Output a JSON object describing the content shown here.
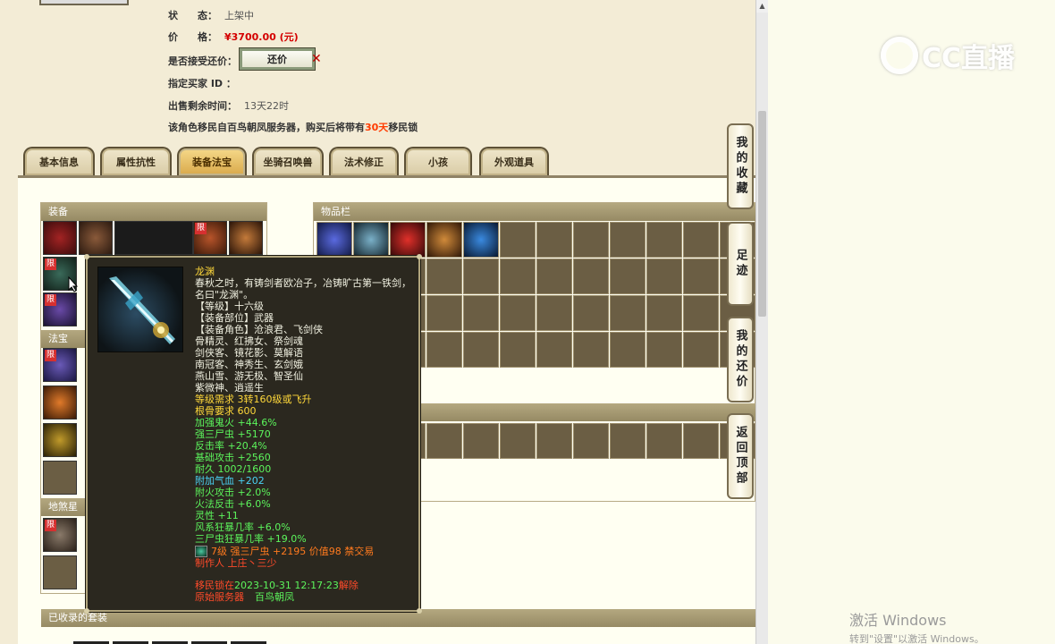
{
  "info": {
    "status_label": "状　　态：",
    "status_value": "上架中",
    "price_label": "价　　格：",
    "price_value": "¥3700.00 (元)",
    "accept_label": "是否接受还价：",
    "counter_button": "还价",
    "buyer_label": "指定买家 ID ：",
    "remaining_label": "出售剩余时间：",
    "remaining_value": "13天22时",
    "migrate_prefix": "该角色移民自百鸟朝凤服务器，购买后将带有",
    "migrate_highlight": "30天",
    "migrate_suffix": "移民锁"
  },
  "tabs": [
    "基本信息",
    "属性抗性",
    "装备法宝",
    "坐骑召唤兽",
    "法术修正",
    "小孩",
    "外观道具"
  ],
  "active_tab": "装备法宝",
  "panels": {
    "equipment": "装备",
    "inventory": "物品栏",
    "treasure": "法宝",
    "earth_treasure": "地煞星",
    "collected_sets": "已收录的套装"
  },
  "limit_badge": "限",
  "side_nav": [
    "我的收藏",
    "足迹",
    "我的还价",
    "返回顶部"
  ],
  "tooltip": {
    "name": "龙渊",
    "desc": "春秋之时，有铸剑者欧冶子，冶铸旷古第一铁剑，名曰\"龙渊\"。",
    "lines": [
      {
        "text": "【等级】十六级",
        "color": "white"
      },
      {
        "text": "【装备部位】武器",
        "color": "white"
      },
      {
        "text": "【装备角色】沧浪君、飞剑侠",
        "color": "white"
      },
      {
        "text": "骨精灵、红拂女、祭剑魂",
        "color": "white"
      },
      {
        "text": "剑侠客、镜花影、莫解语",
        "color": "white"
      },
      {
        "text": "南冠客、神秀生、玄剑娥",
        "color": "white"
      },
      {
        "text": "燕山雪、游无极、智圣仙",
        "color": "white"
      },
      {
        "text": "紫微神、逍遥生",
        "color": "white"
      },
      {
        "text": "等级需求 3转160级或飞升",
        "color": "yellow"
      },
      {
        "text": "根骨要求 600",
        "color": "yellow"
      },
      {
        "text": "加强鬼火 +44.6%",
        "color": "green"
      },
      {
        "text": "强三尸虫 +5170",
        "color": "green"
      },
      {
        "text": "反击率 +20.4%",
        "color": "green"
      },
      {
        "text": "基础攻击 +2560",
        "color": "green"
      },
      {
        "text": "耐久 1002/1600",
        "color": "green"
      },
      {
        "text": "附加气血 +202",
        "color": "cyan"
      },
      {
        "text": "附火攻击 +2.0%",
        "color": "green"
      },
      {
        "text": "火法反击 +6.0%",
        "color": "green"
      },
      {
        "text": "灵性 +11",
        "color": "green"
      },
      {
        "text": "风系狂暴几率 +6.0%",
        "color": "green"
      },
      {
        "text": "三尸虫狂暴几率 +19.0%",
        "color": "green"
      }
    ],
    "gem_line": "7级 强三尸虫 +2195 价值98 禁交易",
    "maker": "制作人 上庄丶三少",
    "migrate_prefix": "移民锁在",
    "migrate_time": "2023-10-31 12:17:23",
    "migrate_suffix": "解除",
    "origin_label": "原始服务器",
    "origin_server": "百鸟朝凤"
  },
  "watermark": "CC直播",
  "activate_windows": {
    "title": "激活 Windows",
    "subtitle": "转到\"设置\"以激活 Windows。"
  },
  "colors": {
    "price": "#d40000",
    "highlight": "#ff3b00",
    "tooltip_bg": "#2b281f",
    "panel_header": "#a89c74",
    "grid_cell": "#6b5e44"
  }
}
